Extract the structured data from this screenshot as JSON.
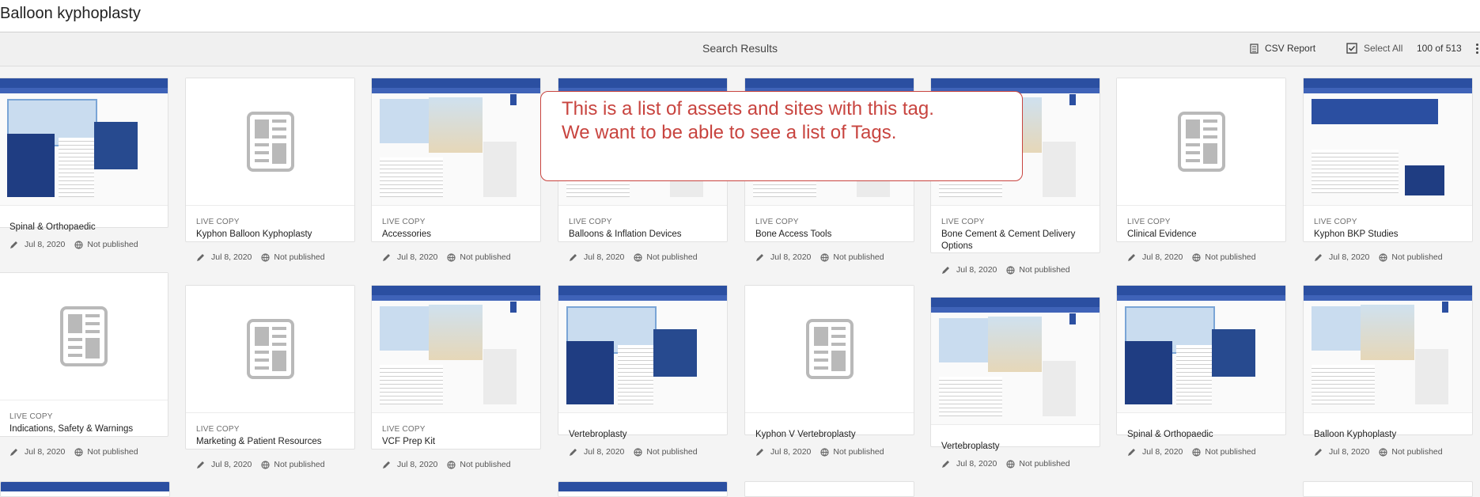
{
  "header": {
    "title": "Balloon kyphoplasty"
  },
  "results_bar": {
    "title": "Search Results",
    "csv_label": "CSV Report",
    "select_all_label": "Select All",
    "count": "100 of 513"
  },
  "annotation": {
    "line1": "This is a list of assets and sites with this tag.",
    "line2": "We want to be able to see a list of Tags."
  },
  "cards": [
    {
      "type": "",
      "name": "Spinal & Orthopaedic",
      "date": "Jul 8, 2020",
      "status": "Not published"
    },
    {
      "type": "LIVE COPY",
      "name": "Kyphon Balloon Kyphoplasty",
      "date": "Jul 8, 2020",
      "status": "Not published"
    },
    {
      "type": "LIVE COPY",
      "name": "Accessories",
      "date": "Jul 8, 2020",
      "status": "Not published"
    },
    {
      "type": "LIVE COPY",
      "name": "Balloons & Inflation Devices",
      "date": "Jul 8, 2020",
      "status": "Not published"
    },
    {
      "type": "LIVE COPY",
      "name": "Bone Access Tools",
      "date": "Jul 8, 2020",
      "status": "Not published"
    },
    {
      "type": "LIVE COPY",
      "name": "Bone Cement & Cement Delivery Options",
      "date": "Jul 8, 2020",
      "status": "Not published"
    },
    {
      "type": "LIVE COPY",
      "name": "Clinical Evidence",
      "date": "Jul 8, 2020",
      "status": "Not published"
    },
    {
      "type": "LIVE COPY",
      "name": "Kyphon BKP Studies",
      "date": "Jul 8, 2020",
      "status": "Not published"
    },
    {
      "type": "LIVE COPY",
      "name": "Indications, Safety & Warnings",
      "date": "Jul 8, 2020",
      "status": "Not published"
    },
    {
      "type": "LIVE COPY",
      "name": "Marketing & Patient Resources",
      "date": "Jul 8, 2020",
      "status": "Not published"
    },
    {
      "type": "LIVE COPY",
      "name": "VCF Prep Kit",
      "date": "Jul 8, 2020",
      "status": "Not published"
    },
    {
      "type": "",
      "name": "Vertebroplasty",
      "date": "Jul 8, 2020",
      "status": "Not published"
    },
    {
      "type": "",
      "name": "Kyphon V Vertebroplasty",
      "date": "Jul 8, 2020",
      "status": "Not published"
    },
    {
      "type": "",
      "name": "Vertebroplasty",
      "date": "Jul 8, 2020",
      "status": "Not published"
    },
    {
      "type": "",
      "name": "Spinal & Orthopaedic",
      "date": "Jul 8, 2020",
      "status": "Not published"
    },
    {
      "type": "",
      "name": "Balloon Kyphoplasty",
      "date": "Jul 8, 2020",
      "status": "Not published"
    }
  ],
  "colors": {
    "annotation": "#c8443f",
    "site_header": "#2b4fa1"
  }
}
